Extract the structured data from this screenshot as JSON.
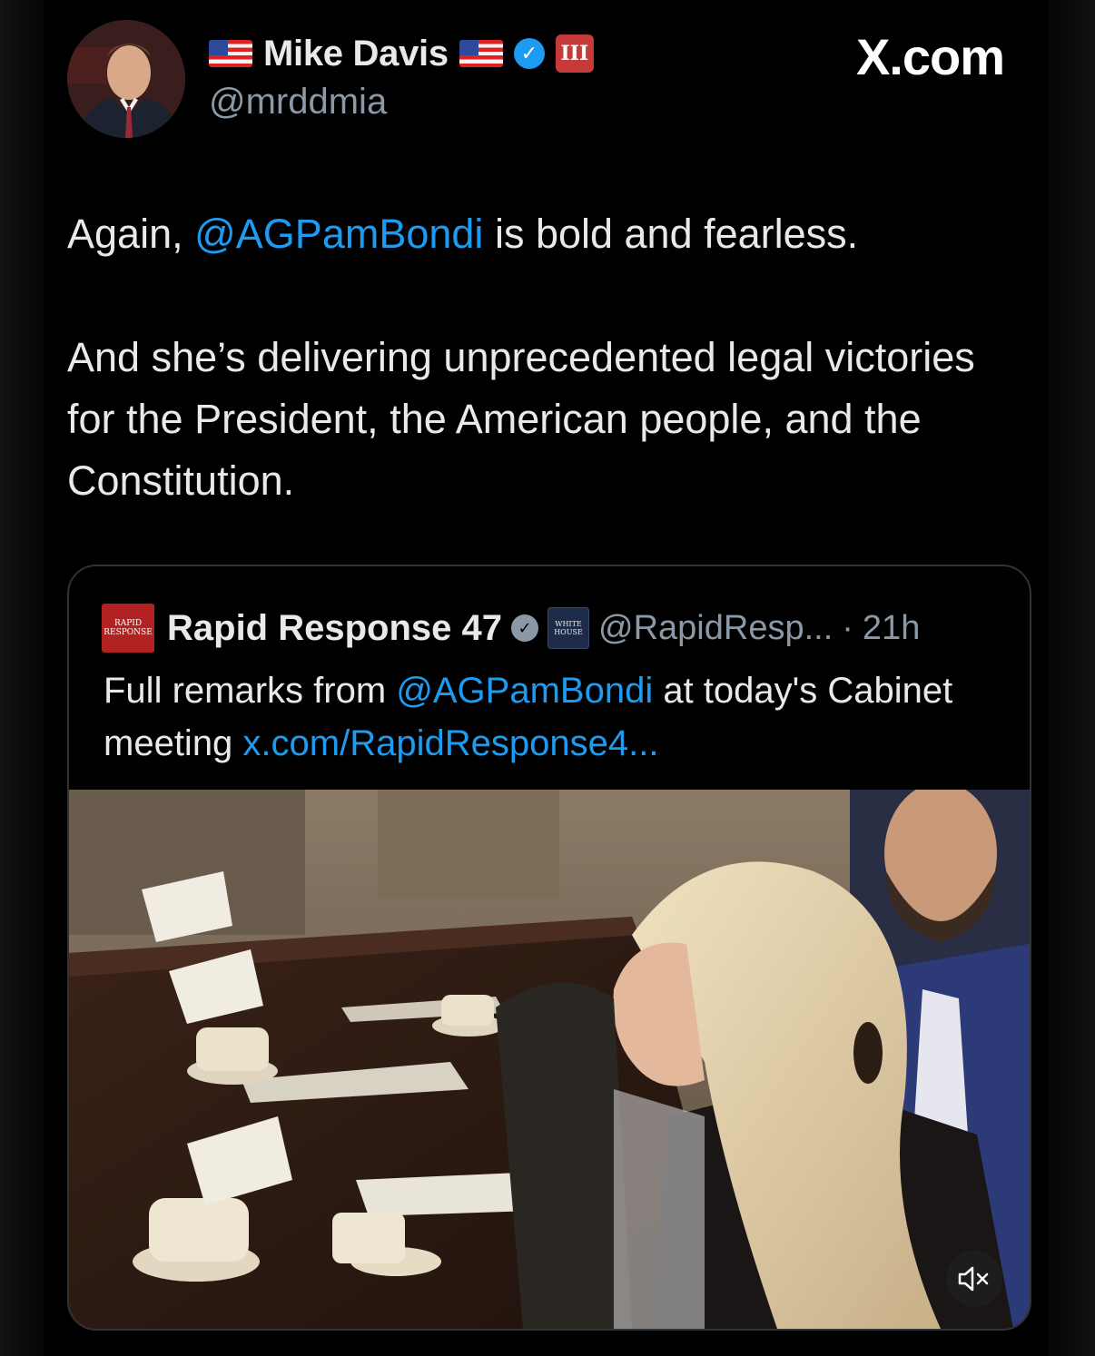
{
  "header": {
    "display_name": "Mike Davis",
    "handle": "@mrddmia",
    "site_badge": "X.com",
    "gov_badge_text": "III"
  },
  "tweet": {
    "mention_prefix": "Again, ",
    "mention": "@AGPamBondi",
    "line1_suffix": " is bold and fearless.",
    "paragraph2": "And she’s delivering unprecedented legal victories for the President, the American people, and the Constitution."
  },
  "quote": {
    "logo_text_1": "RAPID",
    "logo_text_2": "RESPONSE",
    "author_name": "Rapid Response 47",
    "affiliation_text_1": "WHITE",
    "affiliation_text_2": "HOUSE",
    "handle": "@RapidResp...",
    "separator": "·",
    "time": "21h",
    "text_prefix": "Full remarks from ",
    "text_mention": "@AGPamBondi",
    "text_middle": " at today's Cabinet meeting ",
    "text_link": "x.com/RapidResponse4..."
  },
  "colors": {
    "accent": "#1d9bf0",
    "secondary_text": "#8b98a5",
    "primary_text": "#e7e9ea",
    "background": "#000000",
    "gov_badge": "#c63a3a"
  }
}
